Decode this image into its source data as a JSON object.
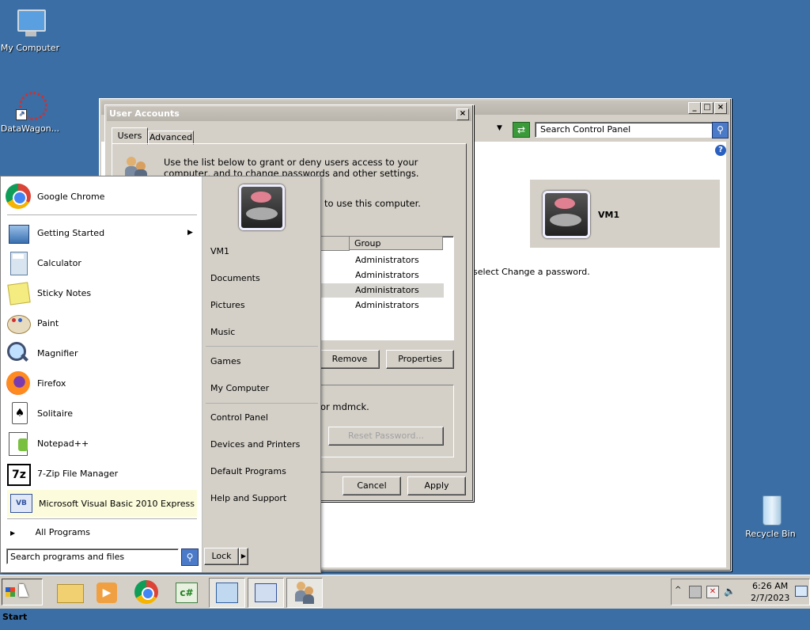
{
  "desktop": {
    "icons": [
      {
        "label": "My Computer"
      },
      {
        "label": "DataWagon..."
      },
      {
        "label": "Recycle Bin"
      }
    ]
  },
  "control_panel": {
    "search_placeholder": "Search Control Panel",
    "user_card_name": "VM1",
    "password_hint": "select Change a password."
  },
  "user_accounts": {
    "title": "User Accounts",
    "tabs": [
      "Users",
      "Advanced"
    ],
    "intro": "Use the list below to grant or deny users access to your computer, and to change passwords and other settings.",
    "users_label_tail": "to use this computer.",
    "table": {
      "headers": [
        "",
        "Group"
      ],
      "rows": [
        "Administrators",
        "Administrators",
        "Administrators",
        "Administrators"
      ],
      "selected_index": 2
    },
    "remove_button": "Remove",
    "properties_button": "Properties",
    "password_text_tail": "or mdmck.",
    "reset_button": "Reset Password...",
    "cancel_button": "Cancel",
    "apply_button": "Apply"
  },
  "start_menu": {
    "pinned": "Google Chrome",
    "programs": [
      "Getting Started",
      "Calculator",
      "Sticky Notes",
      "Paint",
      "Magnifier",
      "Firefox",
      "Solitaire",
      "Notepad++",
      "7-Zip File Manager",
      "Microsoft Visual Basic 2010 Express"
    ],
    "all_programs": "All Programs",
    "search_placeholder": "Search programs and files",
    "right_items": [
      "VM1",
      "Documents",
      "Pictures",
      "Music",
      "Games",
      "My Computer",
      "Control Panel",
      "Devices and Printers",
      "Default Programs",
      "Help and Support"
    ],
    "lock_button": "Lock"
  },
  "taskbar": {
    "start_label": "Start",
    "time": "6:26 AM",
    "date": "2/7/2023"
  }
}
